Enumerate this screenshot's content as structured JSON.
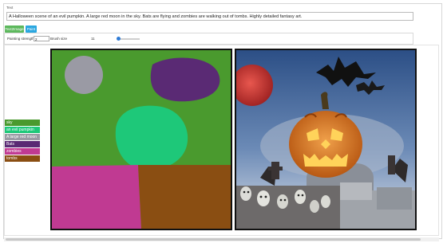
{
  "prompt": {
    "label": "Text",
    "value": "A Halloween scene of an evil pumpkin. A large red moon in the sky. Bats are flying and zombies are walking out of tombs. Highly detailed fantasy art."
  },
  "modes": {
    "text2image": "Text2Image",
    "paint": "Paint"
  },
  "controls": {
    "strength_label": "Painting strength",
    "strength_value": "2",
    "brush_label": "Brush size",
    "brush_value": "11"
  },
  "legend": [
    {
      "label": "sky",
      "color": "#4a9a2e"
    },
    {
      "label": "an evil pumpkin",
      "color": "#1ec879"
    },
    {
      "label": "A large red moon",
      "color": "#9a9aa4"
    },
    {
      "label": "Bats",
      "color": "#5a2a74"
    },
    {
      "label": "zombies",
      "color": "#c03a92"
    },
    {
      "label": "tombs",
      "color": "#8a4e12"
    }
  ],
  "colors": {
    "accent_green": "#5cb85c",
    "accent_blue": "#2aa7e0"
  }
}
